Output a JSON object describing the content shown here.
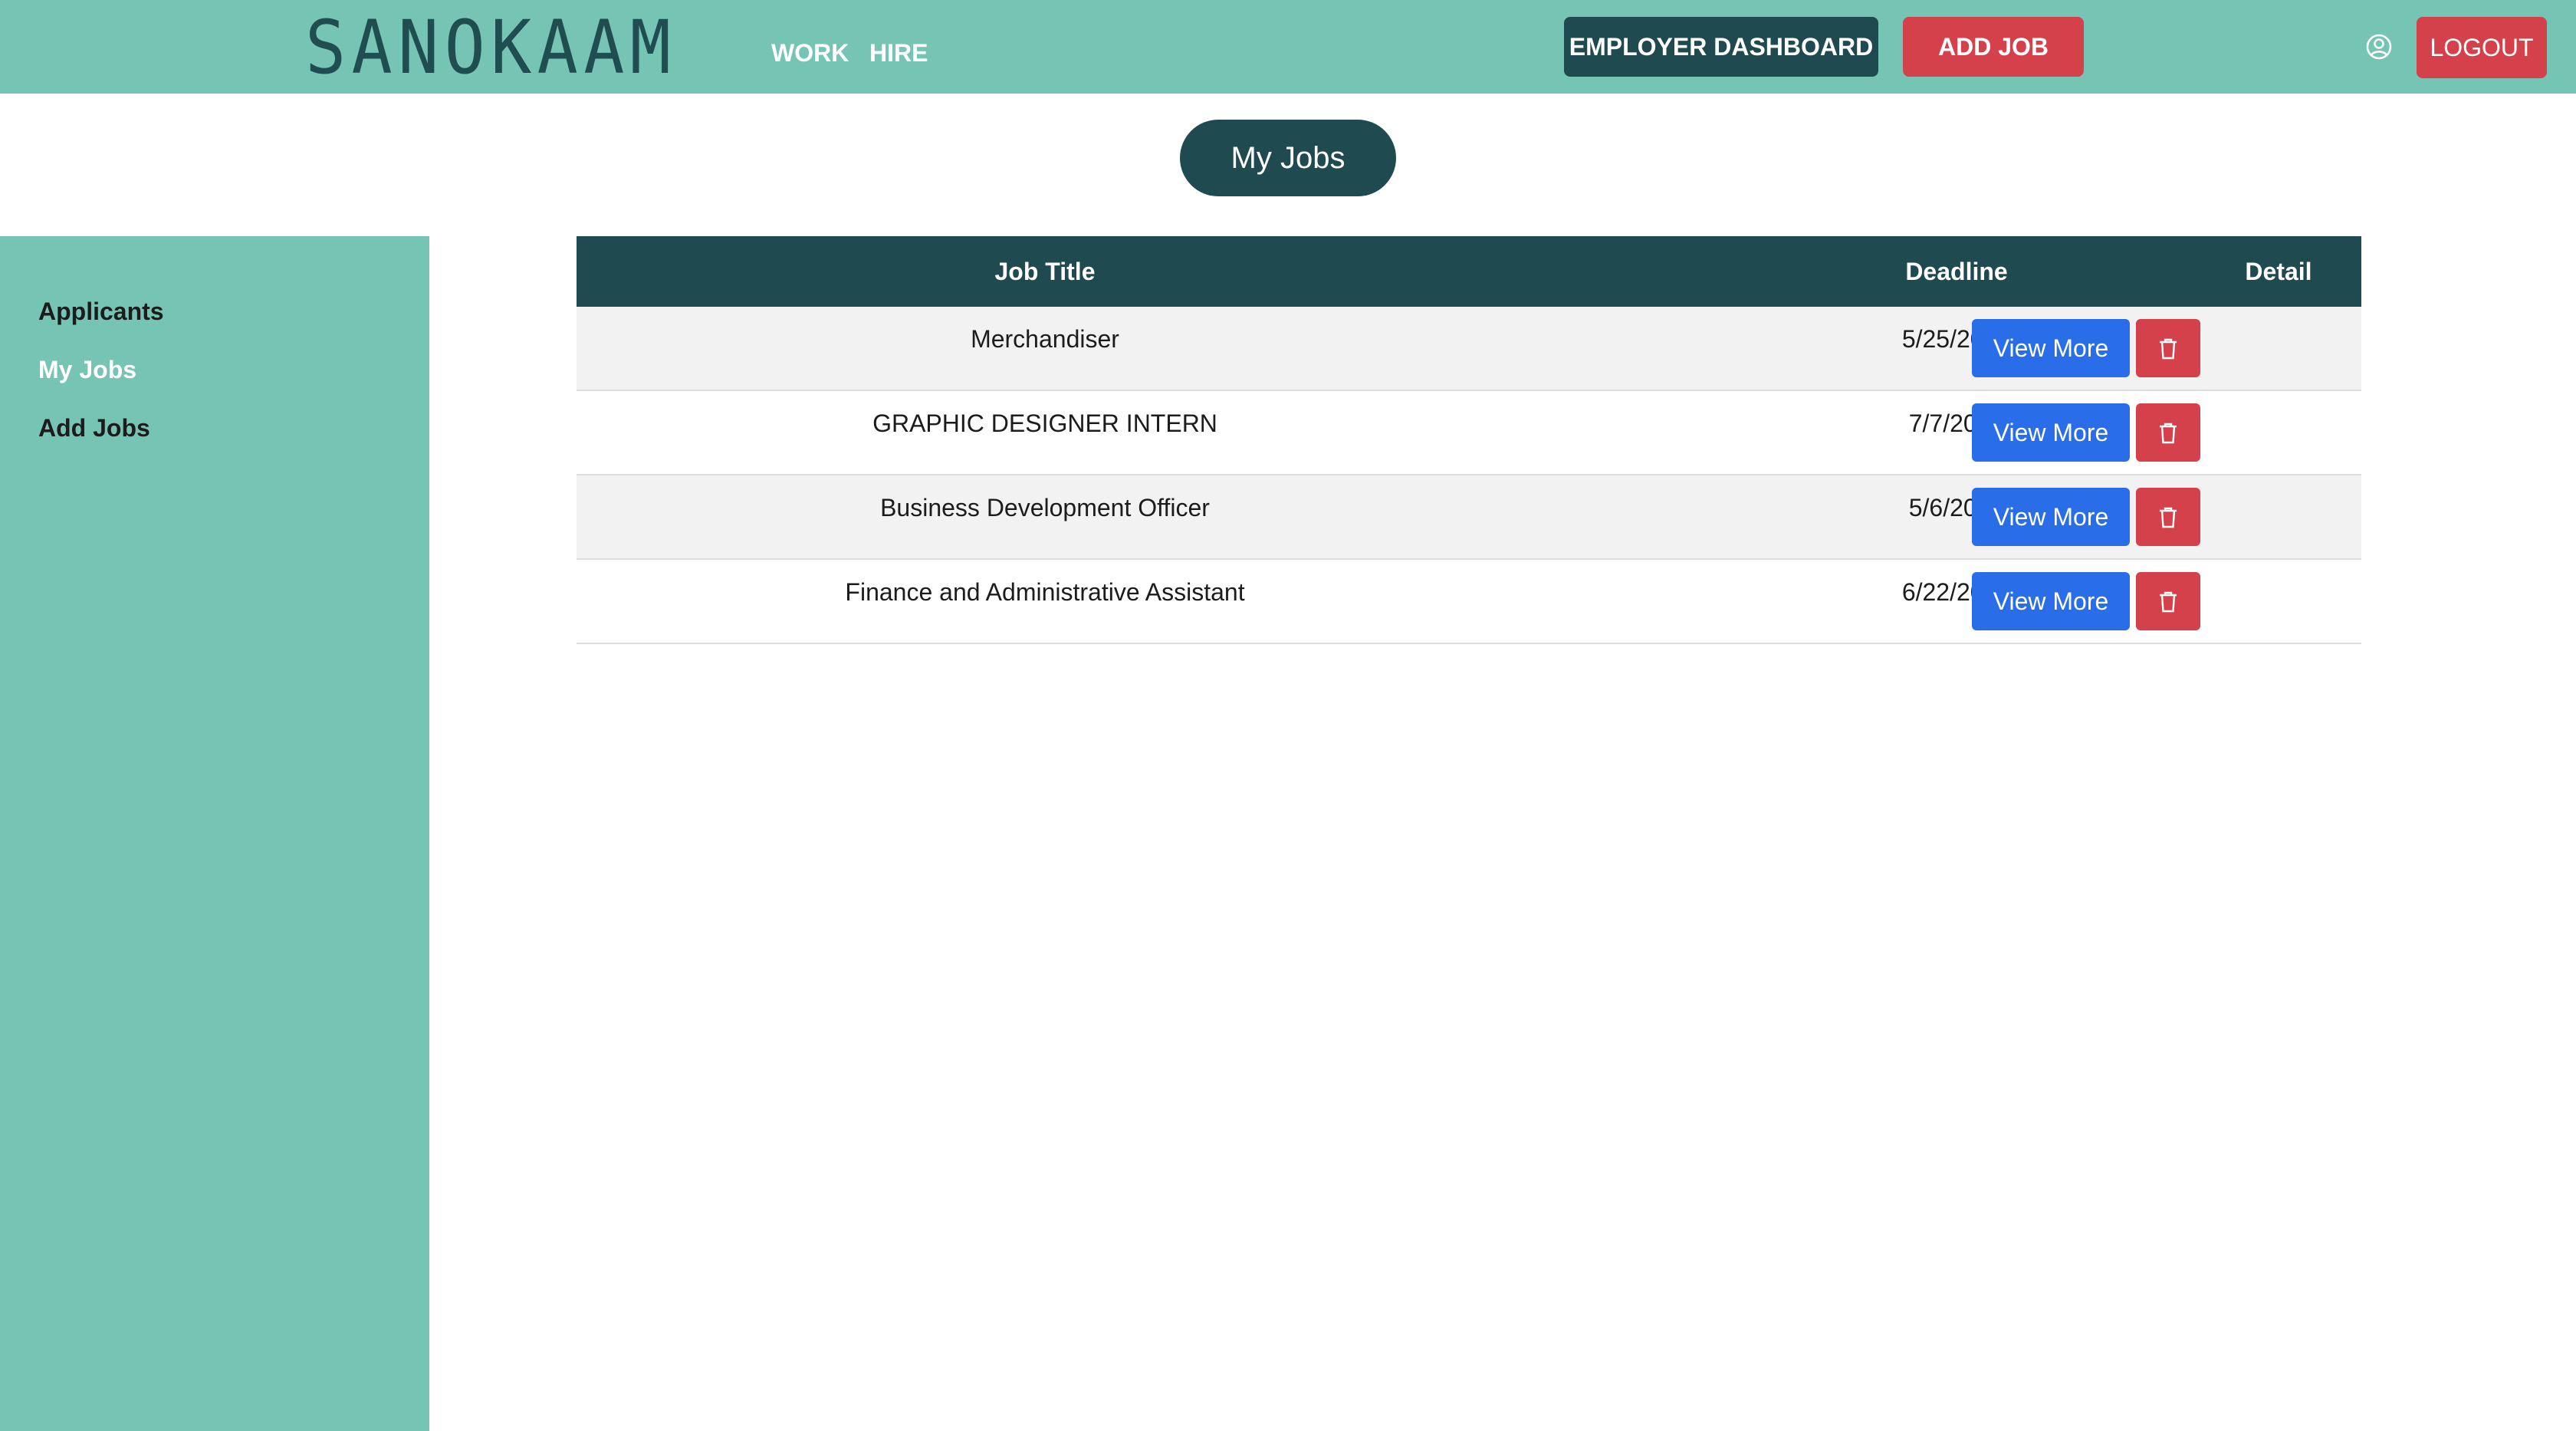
{
  "navbar": {
    "logo": "SANOKAAM",
    "links": [
      {
        "label": "WORK"
      },
      {
        "label": "HIRE"
      }
    ],
    "employer_dashboard_label": "EMPLOYER DASHBOARD",
    "add_job_label": "ADD JOB",
    "user_icon": "user-circle-icon",
    "logout_label": "LOGOUT"
  },
  "page_title": "My Jobs",
  "sidebar": {
    "items": [
      {
        "label": "Applicants",
        "active": false
      },
      {
        "label": "My Jobs",
        "active": true
      },
      {
        "label": "Add Jobs",
        "active": false
      }
    ]
  },
  "table": {
    "headers": [
      "Job Title",
      "Deadline",
      "Detail"
    ],
    "rows": [
      {
        "title": "Merchandiser",
        "deadline": "5/25/2023",
        "action": "View More"
      },
      {
        "title": "GRAPHIC DESIGNER INTERN",
        "deadline": "7/7/2023",
        "action": "View More"
      },
      {
        "title": "Business Development Officer",
        "deadline": "5/6/2023",
        "action": "View More"
      },
      {
        "title": "Finance and Administrative Assistant",
        "deadline": "6/22/2023",
        "action": "View More"
      }
    ],
    "delete_icon": "trash-icon"
  },
  "colors": {
    "navbar_bg": "#76c4b4",
    "primary_dark": "#1f4a4f",
    "danger": "#d5414a",
    "view_button": "#2a6de8"
  }
}
